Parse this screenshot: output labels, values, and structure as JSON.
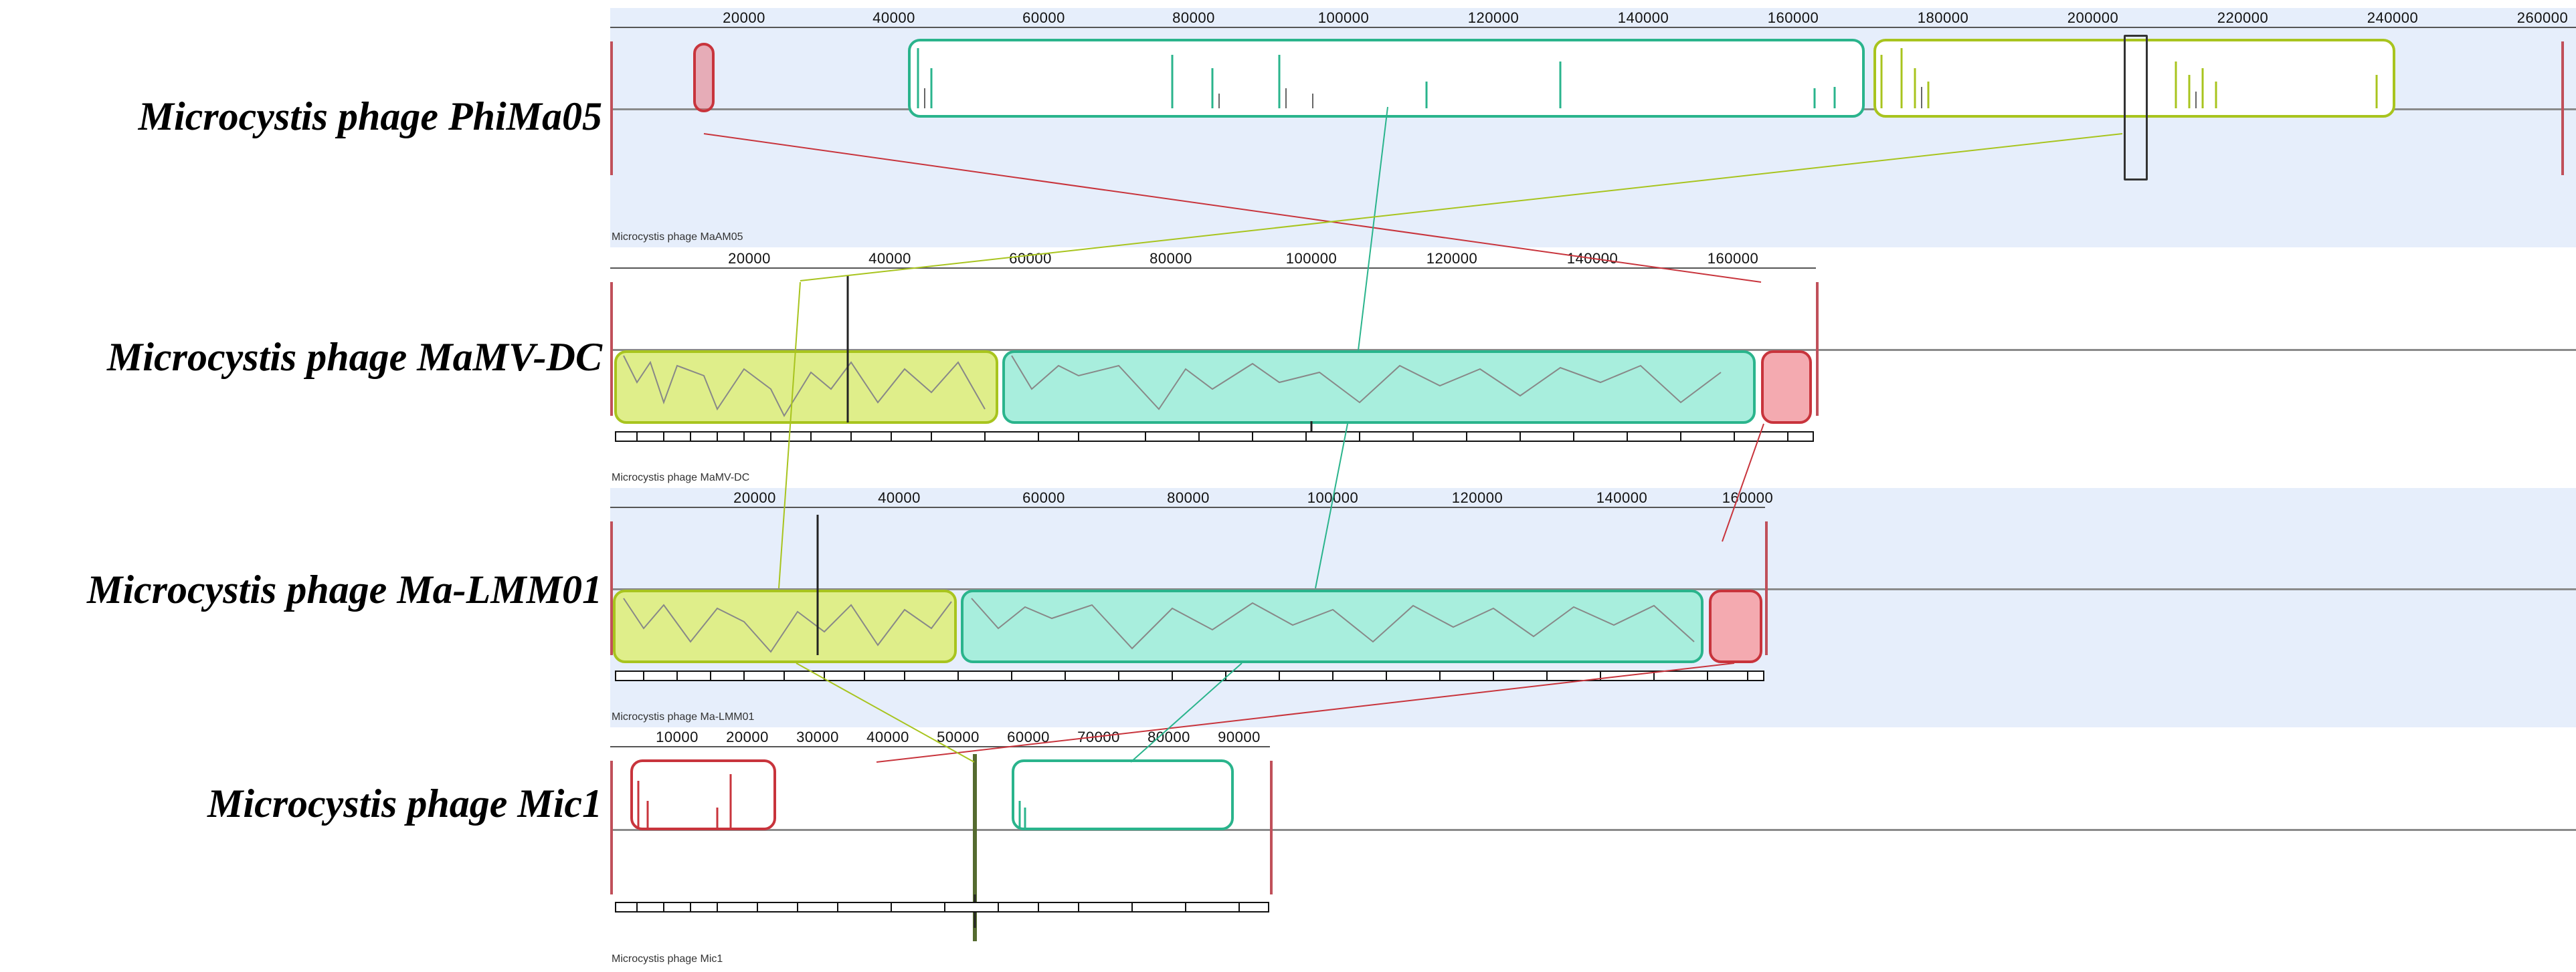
{
  "genomes": [
    {
      "id": "phima05",
      "label": "Microcystis phage PhiMa05",
      "track_name": "Microcystis phage MaAM05",
      "ticks": [
        "20000",
        "40000",
        "60000",
        "80000",
        "100000",
        "120000",
        "140000",
        "160000",
        "180000",
        "200000",
        "220000",
        "240000",
        "260000"
      ]
    },
    {
      "id": "mamvdc",
      "label": "Microcystis phage MaMV-DC",
      "track_name": "Microcystis phage MaMV-DC",
      "ticks": [
        "20000",
        "40000",
        "60000",
        "80000",
        "100000",
        "120000",
        "140000",
        "160000"
      ]
    },
    {
      "id": "malmm01",
      "label": "Microcystis phage Ma-LMM01",
      "track_name": "Microcystis phage Ma-LMM01",
      "ticks": [
        "20000",
        "40000",
        "60000",
        "80000",
        "100000",
        "120000",
        "140000",
        "160000"
      ]
    },
    {
      "id": "mic1",
      "label": "Microcystis phage Mic1",
      "track_name": "Microcystis phage Mic1",
      "ticks": [
        "10000",
        "20000",
        "30000",
        "40000",
        "50000",
        "60000",
        "70000",
        "80000",
        "90000"
      ]
    }
  ],
  "colors": {
    "panel_bg": "#e6eefb",
    "red_block": "#c8343c",
    "teal_block": "#2ab48c",
    "yellow_block": "#a8c41e"
  }
}
